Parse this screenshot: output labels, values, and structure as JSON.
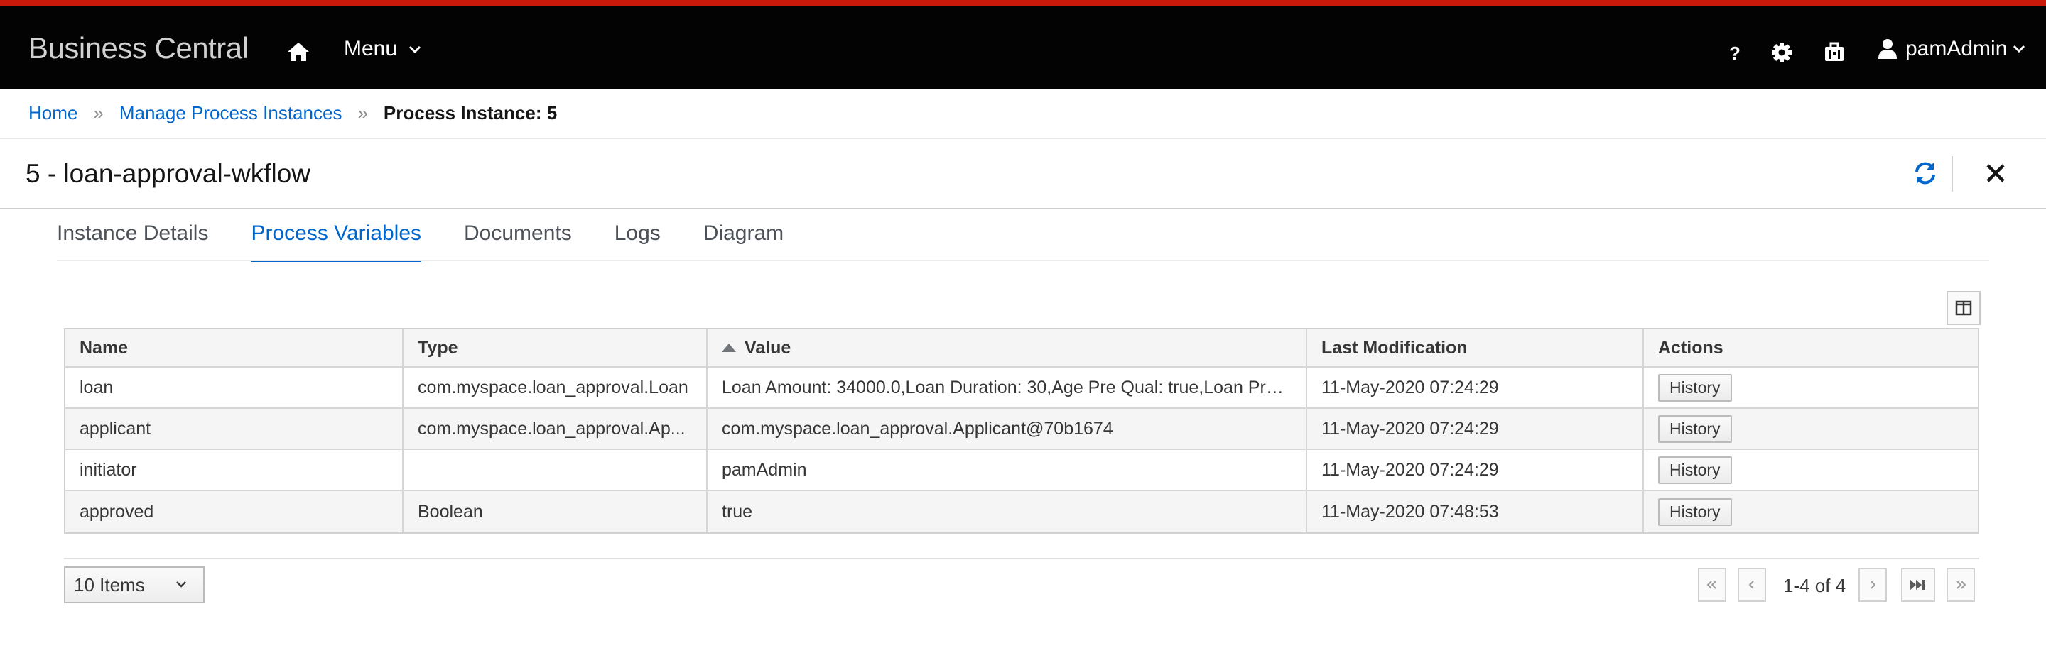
{
  "header": {
    "brand": "Business Central",
    "menu_label": "Menu",
    "user_name": "pamAdmin",
    "help_label": "?"
  },
  "breadcrumb": {
    "items": [
      "Home",
      "Manage Process Instances"
    ],
    "current": "Process Instance: 5",
    "separator": "»"
  },
  "page": {
    "title": "5 - loan-approval-wkflow"
  },
  "tabs": [
    {
      "label": "Instance Details",
      "active": false
    },
    {
      "label": "Process Variables",
      "active": true
    },
    {
      "label": "Documents",
      "active": false
    },
    {
      "label": "Logs",
      "active": false
    },
    {
      "label": "Diagram",
      "active": false
    }
  ],
  "table": {
    "columns": [
      "Name",
      "Type",
      "Value",
      "Last Modification",
      "Actions"
    ],
    "sorted_column": "Value",
    "sort_direction": "ascending",
    "rows": [
      {
        "name": "loan",
        "type": "com.myspace.loan_approval.Loan",
        "value": "Loan Amount: 34000.0,Loan Duration: 30,Age Pre Qual: true,Loan Pre ...",
        "modified": "11-May-2020 07:24:29",
        "action": "History"
      },
      {
        "name": "applicant",
        "type": "com.myspace.loan_approval.Ap...",
        "value": "com.myspace.loan_approval.Applicant@70b1674",
        "modified": "11-May-2020 07:24:29",
        "action": "History"
      },
      {
        "name": "initiator",
        "type": "",
        "value": "pamAdmin",
        "modified": "11-May-2020 07:24:29",
        "action": "History"
      },
      {
        "name": "approved",
        "type": "Boolean",
        "value": "true",
        "modified": "11-May-2020 07:48:53",
        "action": "History"
      }
    ]
  },
  "pagination": {
    "page_size": "10 Items",
    "info": "1-4 of 4"
  },
  "colors": {
    "accent": "#0066cc",
    "topbar_bg": "#030303",
    "topbar_stripe": "#c9190b"
  },
  "icons": {
    "home": "home-icon",
    "help": "help-icon",
    "settings": "gear-icon",
    "tasks": "briefcase-icon",
    "user": "user-icon",
    "refresh": "refresh-icon",
    "close": "close-icon",
    "columns": "columns-icon"
  }
}
